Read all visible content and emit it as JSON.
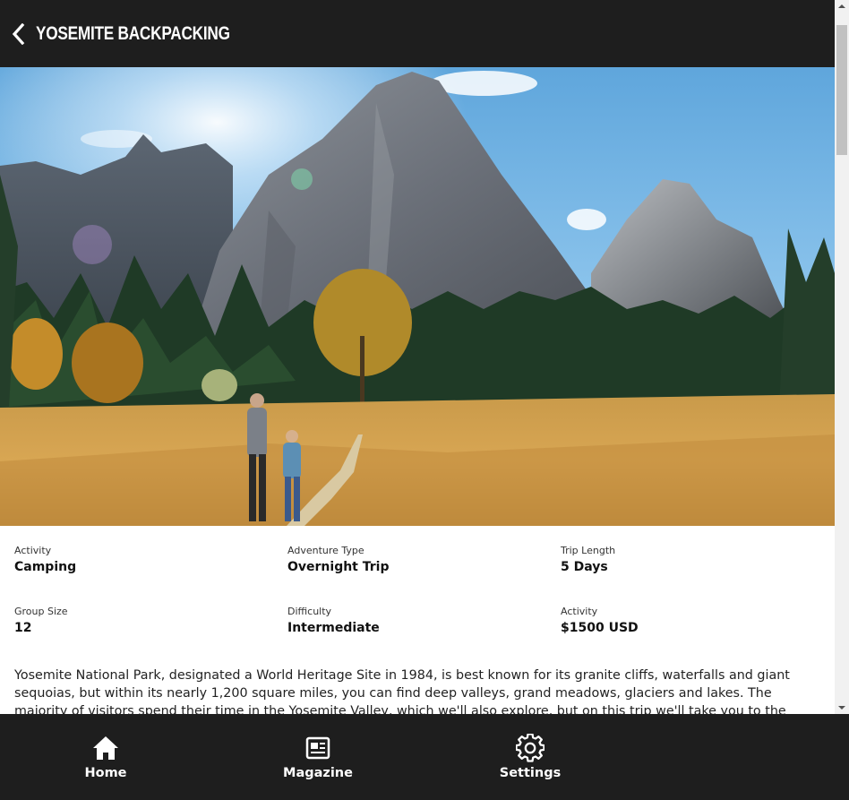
{
  "header": {
    "title": "YOSEMITE BACKPACKING",
    "back_icon": "chevron-left-icon"
  },
  "hero": {
    "image": "yosemite-valley-photo"
  },
  "details": [
    {
      "label": "Activity",
      "value": "Camping"
    },
    {
      "label": "Adventure Type",
      "value": "Overnight Trip"
    },
    {
      "label": "Trip Length",
      "value": "5 Days"
    },
    {
      "label": "Group Size",
      "value": "12"
    },
    {
      "label": "Difficulty",
      "value": "Intermediate"
    },
    {
      "label": "Activity",
      "value": "$1500 USD"
    }
  ],
  "description": "Yosemite National Park, designated a World Heritage Site in 1984, is best known for its granite cliffs, waterfalls and giant sequoias, but within its nearly 1,200 square miles, you can find deep valleys, grand meadows, glaciers and lakes. The majority of visitors spend their time in the Yosemite Valley, which we'll also explore, but on this trip we'll take you to the backcountry that inspired John Muir to lead a",
  "bottom_nav": [
    {
      "label": "Home",
      "icon": "home-icon"
    },
    {
      "label": "Magazine",
      "icon": "newspaper-icon"
    },
    {
      "label": "Settings",
      "icon": "gear-icon"
    }
  ],
  "colors": {
    "bar_background": "#1e1e1e",
    "bar_text": "#ffffff",
    "page_background": "#ffffff"
  }
}
